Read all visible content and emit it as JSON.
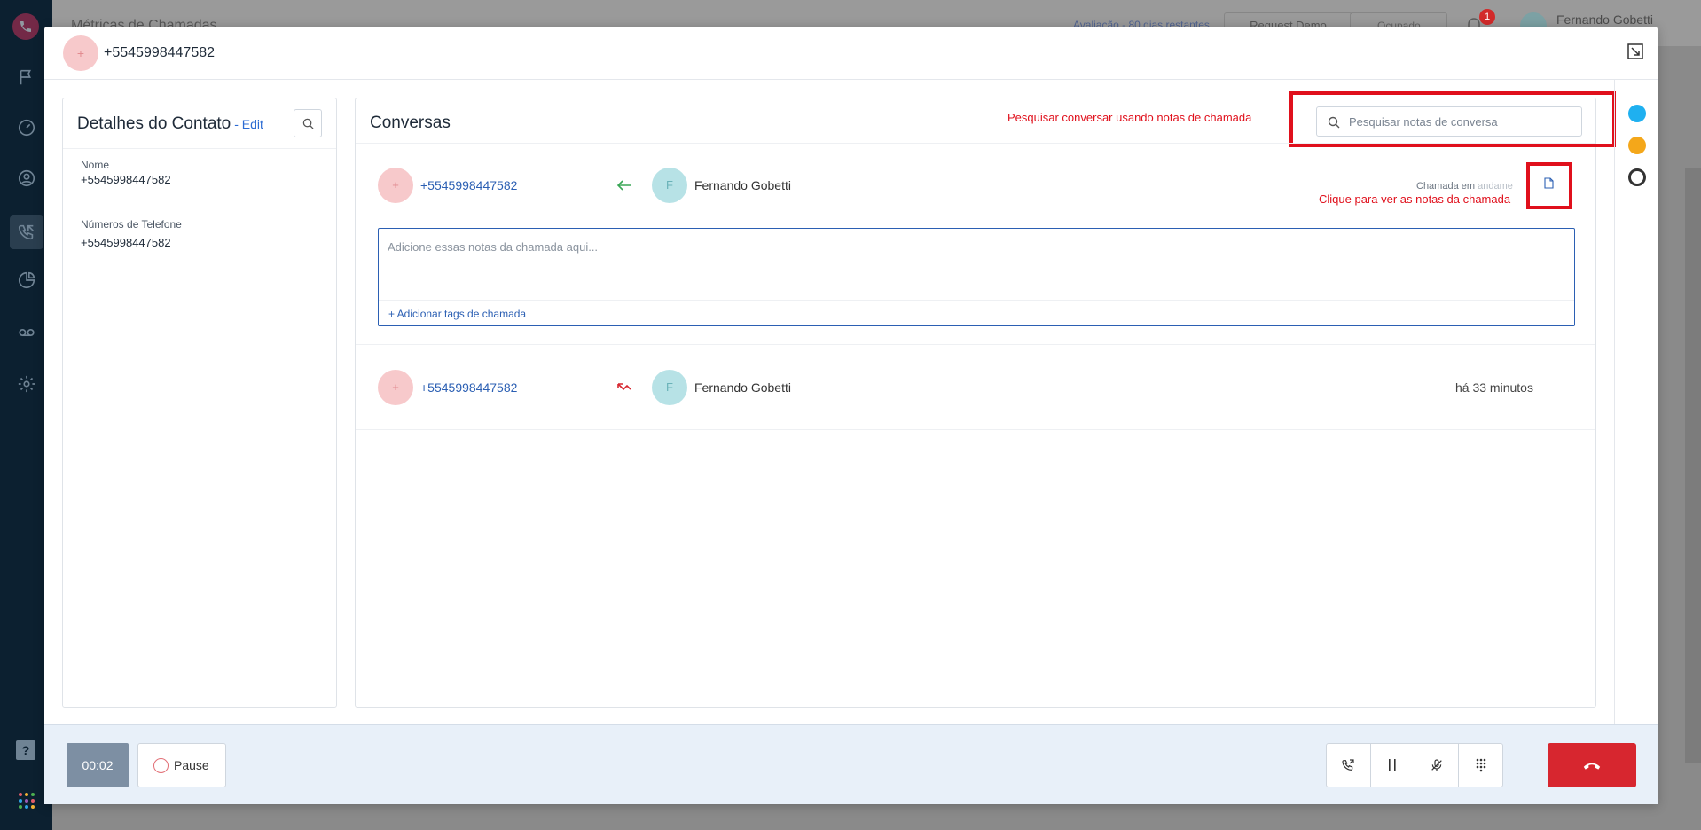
{
  "background": {
    "page_title": "Métricas de Chamadas",
    "trial_notice": "Avaliação - 80 dias restantes",
    "request_demo_label": "Request Demo",
    "status_label": "Ocupado",
    "notification_count": "1",
    "user_name": "Fernando Gobetti"
  },
  "sidebar": {
    "items": [
      {
        "icon": "flag-icon"
      },
      {
        "icon": "dashboard-icon"
      },
      {
        "icon": "contacts-icon"
      },
      {
        "icon": "calls-icon",
        "active": true
      },
      {
        "icon": "reports-icon"
      },
      {
        "icon": "voicemail-icon"
      },
      {
        "icon": "settings-icon"
      }
    ],
    "help_label": "?"
  },
  "modal": {
    "avatar_initial": "+",
    "title": "+5545998447582"
  },
  "contact": {
    "title": "Detalhes do Contato",
    "edit_label": "- Edit",
    "fields": [
      {
        "label": "Nome",
        "value": "+5545998447582"
      },
      {
        "label": "Números de Telefone",
        "value": "+5545998447582"
      }
    ]
  },
  "conversations": {
    "title": "Conversas",
    "search_placeholder": "Pesquisar notas de conversa",
    "annotation_search": "Pesquisar conversar usando notas de chamada",
    "annotation_notes": "Clique para ver as notas da chamada",
    "calls": [
      {
        "caller_initial": "+",
        "caller_number": "+5545998447582",
        "direction": "incoming",
        "agent_initial": "F",
        "agent_name": "Fernando Gobetti",
        "status_prefix": "Chamada em",
        "status_suffix": "andame"
      },
      {
        "caller_initial": "+",
        "caller_number": "+5545998447582",
        "direction": "missed",
        "agent_initial": "F",
        "agent_name": "Fernando Gobetti",
        "time": "há 33 minutos"
      }
    ],
    "notes_placeholder": "Adicione essas notas da chamada aqui...",
    "add_tags_label": "+ Adicionar tags de chamada"
  },
  "footer": {
    "timer": "00:02",
    "pause_label": "Pause"
  },
  "colors": {
    "accent": "#2b5fb3",
    "annotation": "#e0101c",
    "hangup": "#d7262f"
  }
}
